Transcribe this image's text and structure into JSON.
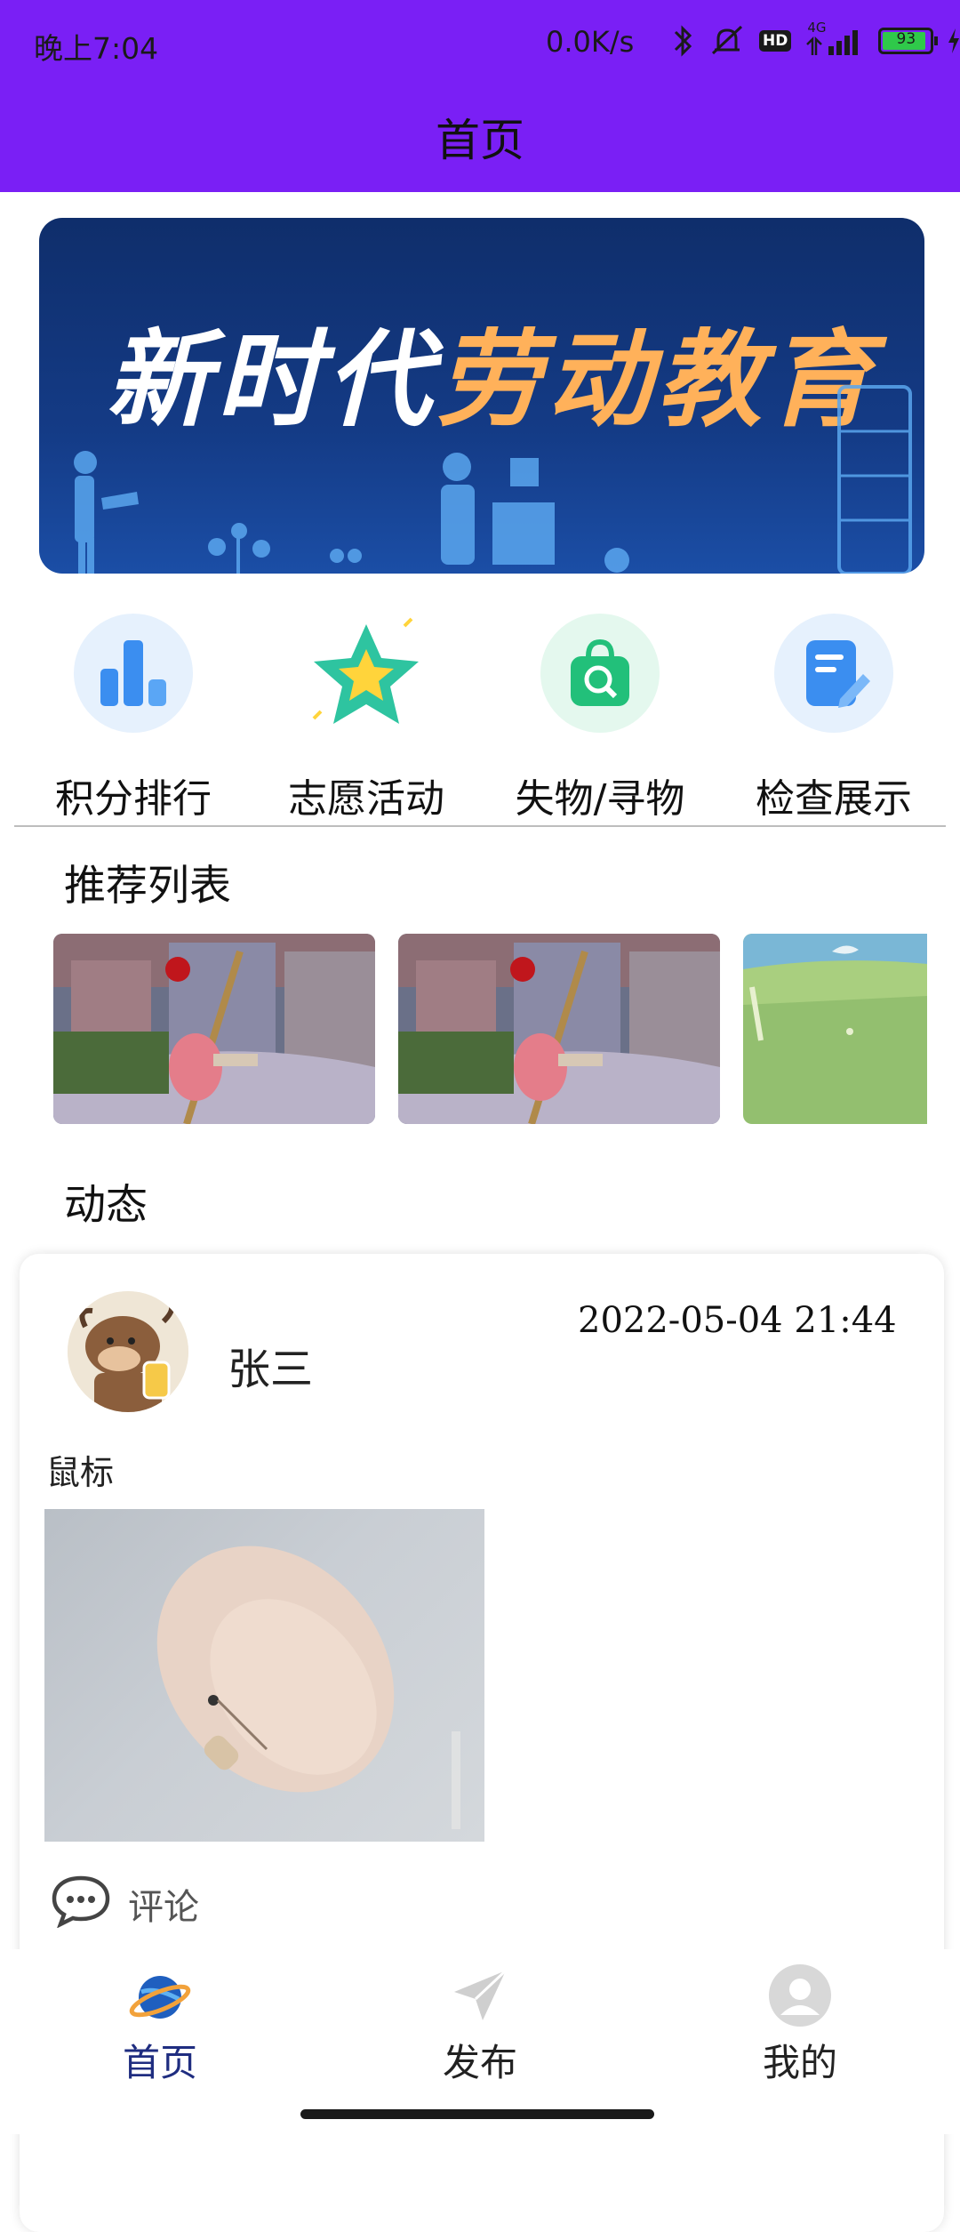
{
  "status_bar": {
    "time": "晚上7:04",
    "network_speed": "0.0K/s",
    "battery_level": "93",
    "signal_label": "4G",
    "hd_label": "HD"
  },
  "header": {
    "title": "首页"
  },
  "banner": {
    "text_part1": "新时代",
    "text_part2": "劳动教育"
  },
  "quick_entries": [
    {
      "label": "积分排行",
      "icon": "bar-chart-icon",
      "color": "#3b8ef0"
    },
    {
      "label": "志愿活动",
      "icon": "star-icon",
      "color": "#2ec4a0"
    },
    {
      "label": "失物/寻物",
      "icon": "shopping-bag-search-icon",
      "color": "#22c07a"
    },
    {
      "label": "检查展示",
      "icon": "document-edit-icon",
      "color": "#3b8ef0"
    }
  ],
  "recommend": {
    "title": "推荐列表"
  },
  "feed": {
    "title": "动态",
    "posts": [
      {
        "username": "张三",
        "time": "2022-05-04 21:44",
        "text": "鼠标",
        "comment_label": "评论"
      }
    ]
  },
  "bottom_nav": {
    "items": [
      {
        "label": "首页",
        "icon": "planet-icon",
        "active": true
      },
      {
        "label": "发布",
        "icon": "paper-plane-icon",
        "active": false
      },
      {
        "label": "我的",
        "icon": "profile-icon",
        "active": false
      }
    ],
    "active_color": "#1f2d80"
  },
  "colors": {
    "accent": "#7a1ff5"
  }
}
